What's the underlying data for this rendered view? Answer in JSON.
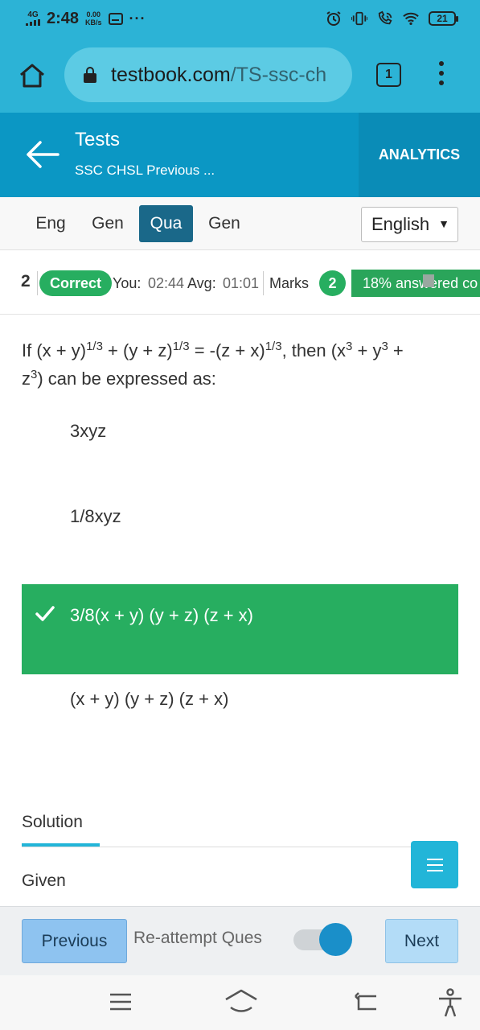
{
  "status_bar": {
    "network": "4G",
    "time": "2:48",
    "speed_value": "0.00",
    "speed_unit": "KB/s",
    "more": "···",
    "battery": "21"
  },
  "browser": {
    "url_host": "testbook.com",
    "url_path": "/TS-ssc-ch",
    "tab_count": "1"
  },
  "header": {
    "title": "Tests",
    "subtitle": "SSC CHSL Previous ...",
    "analytics_label": "ANALYTICS"
  },
  "section_tabs": [
    {
      "label": "Eng",
      "active": false
    },
    {
      "label": "Gen",
      "active": false
    },
    {
      "label": "Qua",
      "active": true
    },
    {
      "label": "Gen",
      "active": false
    }
  ],
  "language": {
    "selected": "English",
    "caret": "▼"
  },
  "question_info": {
    "number": "2",
    "status": "Correct",
    "you_label": "You:",
    "you_time": "02:44",
    "avg_label": "Avg:",
    "avg_time": "01:01",
    "marks_label": "Marks",
    "marks_value": "2",
    "answered_text": "18% answered co"
  },
  "question": {
    "parts": {
      "p1": "If (x + y)",
      "s1": "1/3",
      "p2": " + (y + z)",
      "s2": "1/3",
      "p3": " = -(z + x)",
      "s3": "1/3",
      "p4": ", then (x",
      "s4": "3",
      "p5": " + y",
      "s5": "3",
      "p6": " + z",
      "s6": "3",
      "p7": ") can be expressed as:"
    }
  },
  "options": [
    {
      "text": "3xyz",
      "correct": false
    },
    {
      "text": "1/8xyz",
      "correct": false
    },
    {
      "text": "3/8(x + y) (y + z) (z + x)",
      "correct": true
    },
    {
      "text": "(x + y) (y + z) (z + x)",
      "correct": false
    }
  ],
  "solution": {
    "tab_label": "Solution",
    "first_line": "Given"
  },
  "footer": {
    "previous_label": "Previous",
    "reattempt_label": "Re-attempt Ques",
    "reattempt_on": true,
    "next_label": "Next"
  },
  "colors": {
    "status_bar": "#2cb3d6",
    "app_header": "#0b97c4",
    "active_tab": "#1a6889",
    "correct_green": "#27ae60",
    "accent_cyan": "#22b5d8"
  },
  "icons": {
    "home": "home-icon",
    "lock": "lock-icon",
    "tabs": "tab-count-icon",
    "menu": "more-vertical-icon",
    "back": "back-arrow-icon",
    "check": "check-icon",
    "fab": "menu-icon"
  }
}
